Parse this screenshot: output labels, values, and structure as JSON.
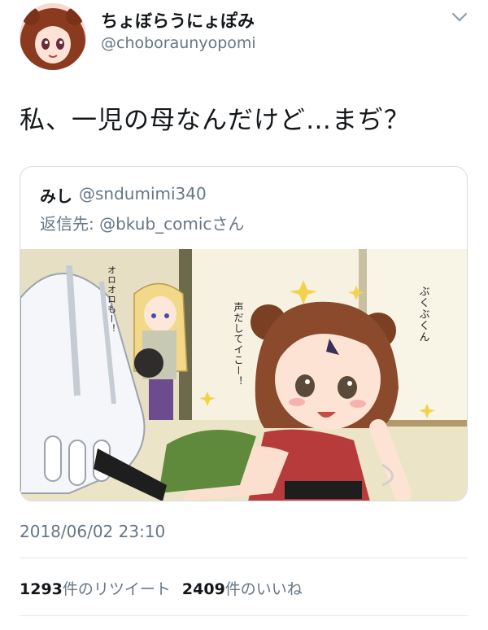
{
  "author": {
    "display_name": "ちょぼらうにょぽみ",
    "handle": "@choboraunyopomi"
  },
  "tweet": {
    "text": "私、一児の母なんだけど…まぢ？",
    "timestamp": "2018/06/02 23:10"
  },
  "quoted_tweet": {
    "display_name": "みし",
    "handle": "@sndumimi340",
    "reply_prefix": "返信先: ",
    "reply_to": "@bkub_comic",
    "reply_suffix": "さん",
    "comic_text": {
      "left_caption": "オロオロもー！",
      "middle_caption": "声だしてイこー！",
      "right_caption": "ぶくぶくん"
    }
  },
  "stats": {
    "retweets_count": "1293",
    "retweets_label": "件のリツイート",
    "likes_count": "2409",
    "likes_label": "件のいいね"
  },
  "icons": {
    "menu": "chevron-down-icon"
  }
}
